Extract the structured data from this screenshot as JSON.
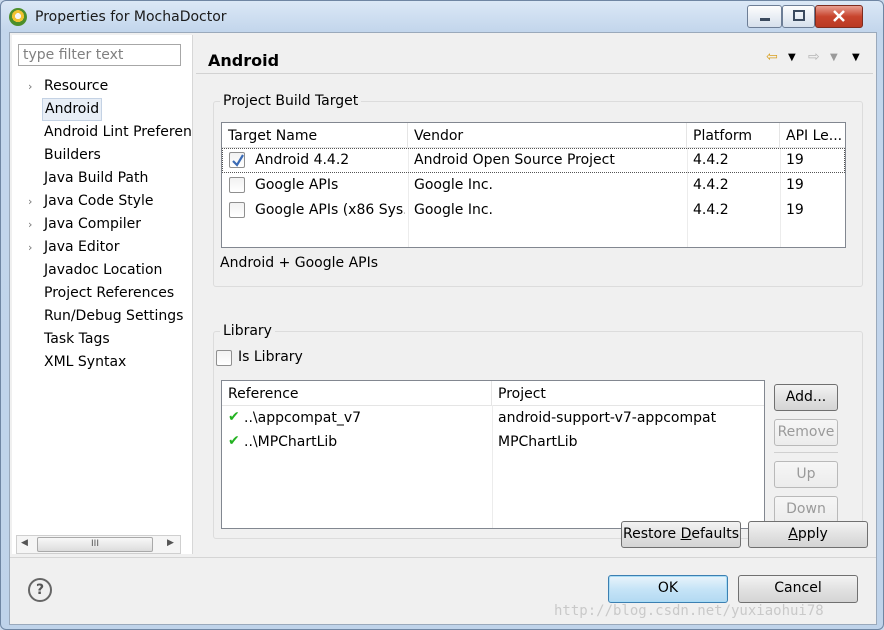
{
  "window": {
    "title": "Properties for MochaDoctor"
  },
  "sidebar": {
    "filter_placeholder": "type filter text",
    "items": [
      {
        "label": "Resource",
        "expandable": true,
        "selected": false
      },
      {
        "label": "Android",
        "expandable": false,
        "selected": true
      },
      {
        "label": "Android Lint Preferen",
        "expandable": false,
        "selected": false
      },
      {
        "label": "Builders",
        "expandable": false,
        "selected": false
      },
      {
        "label": "Java Build Path",
        "expandable": false,
        "selected": false
      },
      {
        "label": "Java Code Style",
        "expandable": true,
        "selected": false
      },
      {
        "label": "Java Compiler",
        "expandable": true,
        "selected": false
      },
      {
        "label": "Java Editor",
        "expandable": true,
        "selected": false
      },
      {
        "label": "Javadoc Location",
        "expandable": false,
        "selected": false
      },
      {
        "label": "Project References",
        "expandable": false,
        "selected": false
      },
      {
        "label": "Run/Debug Settings",
        "expandable": false,
        "selected": false
      },
      {
        "label": "Task Tags",
        "expandable": false,
        "selected": false
      },
      {
        "label": "XML Syntax",
        "expandable": false,
        "selected": false
      }
    ],
    "scrollbar_thumb": "III"
  },
  "page": {
    "title": "Android"
  },
  "build_target": {
    "group_title": "Project Build Target",
    "columns": [
      "Target Name",
      "Vendor",
      "Platform",
      "API Le..."
    ],
    "rows": [
      {
        "checked": true,
        "name": "Android 4.4.2",
        "vendor": "Android Open Source Project",
        "platform": "4.4.2",
        "api": "19"
      },
      {
        "checked": false,
        "name": "Google APIs",
        "vendor": "Google Inc.",
        "platform": "4.4.2",
        "api": "19"
      },
      {
        "checked": false,
        "name": "Google APIs (x86 Sys...",
        "vendor": "Google Inc.",
        "platform": "4.4.2",
        "api": "19"
      }
    ],
    "selected_description": "Android + Google APIs"
  },
  "library": {
    "group_title": "Library",
    "is_library_label": "Is Library",
    "is_library_checked": false,
    "columns": [
      "Reference",
      "Project"
    ],
    "rows": [
      {
        "reference": "..\\appcompat_v7",
        "project": "android-support-v7-appcompat"
      },
      {
        "reference": "..\\MPChartLib",
        "project": "MPChartLib"
      }
    ],
    "buttons": {
      "add": "Add...",
      "remove": "Remove",
      "up": "Up",
      "down": "Down"
    }
  },
  "actions": {
    "restore_defaults_pre": "Restore ",
    "restore_defaults_ul": "D",
    "restore_defaults_post": "efaults",
    "apply_ul": "A",
    "apply_post": "pply"
  },
  "footer": {
    "ok": "OK",
    "cancel": "Cancel",
    "help_glyph": "?"
  },
  "watermark": "http://blog.csdn.net/yuxiaohui78",
  "colors": {
    "check_green": "#23b221",
    "default_button": "#c6e4f7"
  }
}
